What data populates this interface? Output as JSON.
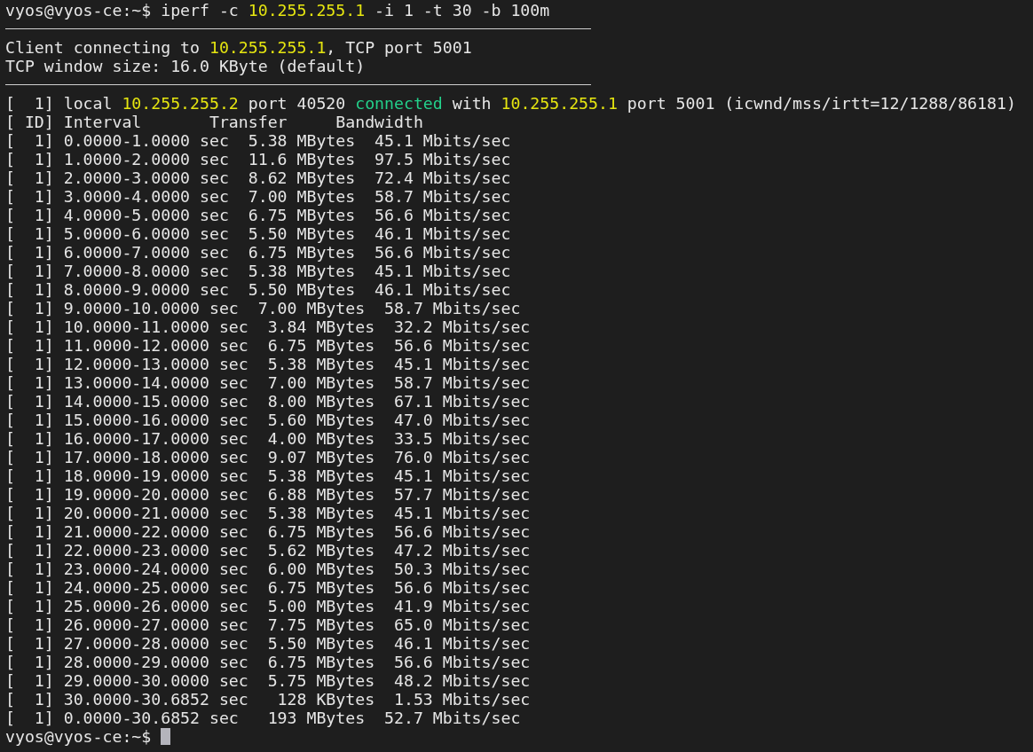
{
  "terminal": {
    "lines": [
      {
        "kind": "text",
        "segments": [
          {
            "text": "vyos@vyos-ce:~$ iperf -c ",
            "kind": "plain"
          },
          {
            "text": "10.255.255.1",
            "kind": "address"
          },
          {
            "text": " -i 1 -t 30 -b 100m",
            "kind": "plain"
          }
        ]
      },
      {
        "kind": "rule"
      },
      {
        "kind": "text",
        "segments": [
          {
            "text": "Client connecting to ",
            "kind": "plain"
          },
          {
            "text": "10.255.255.1",
            "kind": "address"
          },
          {
            "text": ", TCP port 5001",
            "kind": "plain"
          }
        ]
      },
      {
        "kind": "text",
        "segments": [
          {
            "text": "TCP window size: 16.0 KByte (default)",
            "kind": "plain"
          }
        ]
      },
      {
        "kind": "rule"
      },
      {
        "kind": "text",
        "segments": [
          {
            "text": "[  1] local ",
            "kind": "plain"
          },
          {
            "text": "10.255.255.2",
            "kind": "address"
          },
          {
            "text": " port 40520 ",
            "kind": "plain"
          },
          {
            "text": "connected",
            "kind": "status"
          },
          {
            "text": " with ",
            "kind": "plain"
          },
          {
            "text": "10.255.255.1",
            "kind": "address"
          },
          {
            "text": " port 5001 (icwnd/mss/irtt=12/1288/86181)",
            "kind": "plain"
          }
        ]
      },
      {
        "kind": "text",
        "segments": [
          {
            "text": "[ ID] Interval       Transfer     Bandwidth",
            "kind": "plain"
          }
        ]
      },
      {
        "kind": "text",
        "segments": [
          {
            "text": "[  1] 0.0000-1.0000 sec  5.38 MBytes  45.1 Mbits/sec",
            "kind": "plain"
          }
        ]
      },
      {
        "kind": "text",
        "segments": [
          {
            "text": "[  1] 1.0000-2.0000 sec  11.6 MBytes  97.5 Mbits/sec",
            "kind": "plain"
          }
        ]
      },
      {
        "kind": "text",
        "segments": [
          {
            "text": "[  1] 2.0000-3.0000 sec  8.62 MBytes  72.4 Mbits/sec",
            "kind": "plain"
          }
        ]
      },
      {
        "kind": "text",
        "segments": [
          {
            "text": "[  1] 3.0000-4.0000 sec  7.00 MBytes  58.7 Mbits/sec",
            "kind": "plain"
          }
        ]
      },
      {
        "kind": "text",
        "segments": [
          {
            "text": "[  1] 4.0000-5.0000 sec  6.75 MBytes  56.6 Mbits/sec",
            "kind": "plain"
          }
        ]
      },
      {
        "kind": "text",
        "segments": [
          {
            "text": "[  1] 5.0000-6.0000 sec  5.50 MBytes  46.1 Mbits/sec",
            "kind": "plain"
          }
        ]
      },
      {
        "kind": "text",
        "segments": [
          {
            "text": "[  1] 6.0000-7.0000 sec  6.75 MBytes  56.6 Mbits/sec",
            "kind": "plain"
          }
        ]
      },
      {
        "kind": "text",
        "segments": [
          {
            "text": "[  1] 7.0000-8.0000 sec  5.38 MBytes  45.1 Mbits/sec",
            "kind": "plain"
          }
        ]
      },
      {
        "kind": "text",
        "segments": [
          {
            "text": "[  1] 8.0000-9.0000 sec  5.50 MBytes  46.1 Mbits/sec",
            "kind": "plain"
          }
        ]
      },
      {
        "kind": "text",
        "segments": [
          {
            "text": "[  1] 9.0000-10.0000 sec  7.00 MBytes  58.7 Mbits/sec",
            "kind": "plain"
          }
        ]
      },
      {
        "kind": "text",
        "segments": [
          {
            "text": "[  1] 10.0000-11.0000 sec  3.84 MBytes  32.2 Mbits/sec",
            "kind": "plain"
          }
        ]
      },
      {
        "kind": "text",
        "segments": [
          {
            "text": "[  1] 11.0000-12.0000 sec  6.75 MBytes  56.6 Mbits/sec",
            "kind": "plain"
          }
        ]
      },
      {
        "kind": "text",
        "segments": [
          {
            "text": "[  1] 12.0000-13.0000 sec  5.38 MBytes  45.1 Mbits/sec",
            "kind": "plain"
          }
        ]
      },
      {
        "kind": "text",
        "segments": [
          {
            "text": "[  1] 13.0000-14.0000 sec  7.00 MBytes  58.7 Mbits/sec",
            "kind": "plain"
          }
        ]
      },
      {
        "kind": "text",
        "segments": [
          {
            "text": "[  1] 14.0000-15.0000 sec  8.00 MBytes  67.1 Mbits/sec",
            "kind": "plain"
          }
        ]
      },
      {
        "kind": "text",
        "segments": [
          {
            "text": "[  1] 15.0000-16.0000 sec  5.60 MBytes  47.0 Mbits/sec",
            "kind": "plain"
          }
        ]
      },
      {
        "kind": "text",
        "segments": [
          {
            "text": "[  1] 16.0000-17.0000 sec  4.00 MBytes  33.5 Mbits/sec",
            "kind": "plain"
          }
        ]
      },
      {
        "kind": "text",
        "segments": [
          {
            "text": "[  1] 17.0000-18.0000 sec  9.07 MBytes  76.0 Mbits/sec",
            "kind": "plain"
          }
        ]
      },
      {
        "kind": "text",
        "segments": [
          {
            "text": "[  1] 18.0000-19.0000 sec  5.38 MBytes  45.1 Mbits/sec",
            "kind": "plain"
          }
        ]
      },
      {
        "kind": "text",
        "segments": [
          {
            "text": "[  1] 19.0000-20.0000 sec  6.88 MBytes  57.7 Mbits/sec",
            "kind": "plain"
          }
        ]
      },
      {
        "kind": "text",
        "segments": [
          {
            "text": "[  1] 20.0000-21.0000 sec  5.38 MBytes  45.1 Mbits/sec",
            "kind": "plain"
          }
        ]
      },
      {
        "kind": "text",
        "segments": [
          {
            "text": "[  1] 21.0000-22.0000 sec  6.75 MBytes  56.6 Mbits/sec",
            "kind": "plain"
          }
        ]
      },
      {
        "kind": "text",
        "segments": [
          {
            "text": "[  1] 22.0000-23.0000 sec  5.62 MBytes  47.2 Mbits/sec",
            "kind": "plain"
          }
        ]
      },
      {
        "kind": "text",
        "segments": [
          {
            "text": "[  1] 23.0000-24.0000 sec  6.00 MBytes  50.3 Mbits/sec",
            "kind": "plain"
          }
        ]
      },
      {
        "kind": "text",
        "segments": [
          {
            "text": "[  1] 24.0000-25.0000 sec  6.75 MBytes  56.6 Mbits/sec",
            "kind": "plain"
          }
        ]
      },
      {
        "kind": "text",
        "segments": [
          {
            "text": "[  1] 25.0000-26.0000 sec  5.00 MBytes  41.9 Mbits/sec",
            "kind": "plain"
          }
        ]
      },
      {
        "kind": "text",
        "segments": [
          {
            "text": "[  1] 26.0000-27.0000 sec  7.75 MBytes  65.0 Mbits/sec",
            "kind": "plain"
          }
        ]
      },
      {
        "kind": "text",
        "segments": [
          {
            "text": "[  1] 27.0000-28.0000 sec  5.50 MBytes  46.1 Mbits/sec",
            "kind": "plain"
          }
        ]
      },
      {
        "kind": "text",
        "segments": [
          {
            "text": "[  1] 28.0000-29.0000 sec  6.75 MBytes  56.6 Mbits/sec",
            "kind": "plain"
          }
        ]
      },
      {
        "kind": "text",
        "segments": [
          {
            "text": "[  1] 29.0000-30.0000 sec  5.75 MBytes  48.2 Mbits/sec",
            "kind": "plain"
          }
        ]
      },
      {
        "kind": "text",
        "segments": [
          {
            "text": "[  1] 30.0000-30.6852 sec   128 KBytes  1.53 Mbits/sec",
            "kind": "plain"
          }
        ]
      },
      {
        "kind": "text",
        "segments": [
          {
            "text": "[  1] 0.0000-30.6852 sec   193 MBytes  52.7 Mbits/sec",
            "kind": "plain"
          }
        ]
      },
      {
        "kind": "text",
        "cursor": true,
        "segments": [
          {
            "text": "vyos@vyos-ce:~$ ",
            "kind": "plain"
          }
        ]
      }
    ]
  }
}
